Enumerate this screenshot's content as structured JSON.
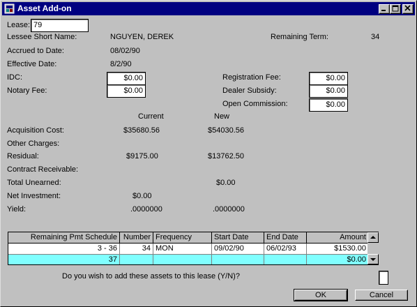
{
  "window": {
    "title": "Asset Add-on"
  },
  "lease": {
    "label": "Lease:",
    "value": "79"
  },
  "lessee": {
    "label": "Lessee Short Name:",
    "value": "NGUYEN, DEREK"
  },
  "remaining_term": {
    "label": "Remaining Term:",
    "value": "34"
  },
  "accrued": {
    "label": "Accrued to Date:",
    "value": "08/02/90"
  },
  "effective": {
    "label": "Effective Date:",
    "value": "8/2/90"
  },
  "idc": {
    "label": "IDC:",
    "value": "$0.00"
  },
  "notary": {
    "label": "Notary Fee:",
    "value": "$0.00"
  },
  "registration": {
    "label": "Registration Fee:",
    "value": "$0.00"
  },
  "dealer": {
    "label": "Dealer Subsidy:",
    "value": "$0.00"
  },
  "open_commission": {
    "label": "Open Commission:",
    "value": "$0.00"
  },
  "columns": {
    "current": "Current",
    "new": "New"
  },
  "rows": {
    "acquisition": {
      "label": "Acquisition Cost:",
      "current": "$35680.56",
      "new": "$54030.56"
    },
    "other": {
      "label": "Other Charges:"
    },
    "residual": {
      "label": "Residual:",
      "current": "$9175.00",
      "new": "$13762.50"
    },
    "contract": {
      "label": "Contract Receivable:"
    },
    "unearned": {
      "label": "Total Unearned:",
      "new": "$0.00"
    },
    "net": {
      "label": "Net Investment:",
      "current": "$0.00"
    },
    "yield": {
      "label": "Yield:",
      "current": ".0000000",
      "new": ".0000000"
    }
  },
  "grid": {
    "headers": [
      "Remaining Pmt Schedule",
      "Number",
      "Frequency",
      "Start Date",
      "End Date",
      "Amount"
    ],
    "row1": [
      "3 -  36",
      "34",
      "MON",
      "09/02/90",
      "06/02/93",
      "$1530.00"
    ],
    "row2": [
      "37",
      "",
      "",
      "",
      "",
      "$0.00"
    ]
  },
  "prompt": {
    "text": "Do you wish to add these assets to this lease (Y/N)?",
    "value": ""
  },
  "buttons": {
    "ok": "OK",
    "cancel": "Cancel"
  },
  "colors": {
    "titlebar": "#000080",
    "highlight_row": "#80ffff",
    "face": "#c0c0c0"
  },
  "icons": {
    "app": "app-window-icon",
    "minimize": "minimize-icon",
    "maximize": "maximize-icon",
    "close": "close-icon"
  }
}
